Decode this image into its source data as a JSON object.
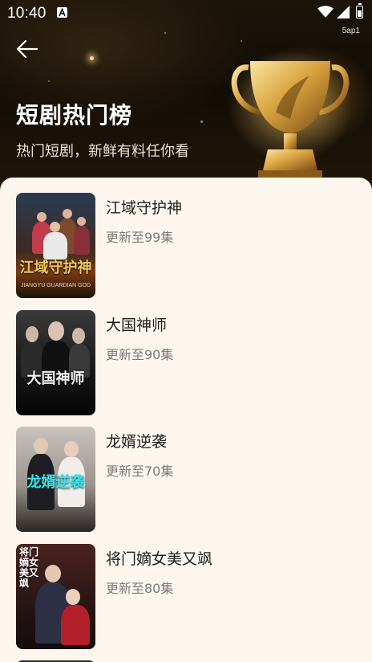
{
  "status_bar": {
    "time": "10:40",
    "carrier": "5ap1"
  },
  "header": {
    "title": "短剧热门榜",
    "subtitle": "热门短剧，新鲜有料任你看"
  },
  "dramas": [
    {
      "title": "江域守护神",
      "status": "更新至99集",
      "poster_text": "江域守护神",
      "poster_subtext": "JIANGYU GUARDIAN GOD"
    },
    {
      "title": "大国神师",
      "status": "更新至90集",
      "poster_text": "大国神师"
    },
    {
      "title": "龙婿逆袭",
      "status": "更新至70集",
      "poster_text": "龙婿逆袭"
    },
    {
      "title": "将门嫡女美又飒",
      "status": "更新至80集",
      "poster_text": "将门嫡女美又飒"
    }
  ],
  "colors": {
    "header_bg": "#1b1409",
    "content_bg": "#fdf6ee",
    "title_text": "#1d1d1d",
    "status_text": "#7a7a7a",
    "trophy_gold": "#d9a441"
  }
}
